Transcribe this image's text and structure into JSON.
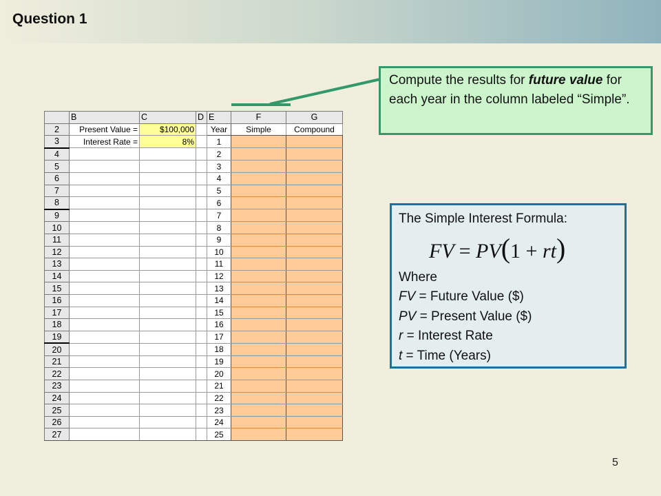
{
  "slide": {
    "title": "Question 1",
    "page_number": "5"
  },
  "callout": {
    "text_1": "Compute the results for ",
    "text_bold": "future value",
    "text_2": " for each year in the column labeled “Simple”."
  },
  "formula_box": {
    "heading": "The Simple Interest Formula:",
    "formula_lhs": "FV",
    "formula_eq": "=",
    "formula_rhs_pv": "PV",
    "formula_open": "(",
    "formula_one": "1",
    "formula_plus": "+",
    "formula_rt": "rt",
    "formula_close": ")",
    "where": "Where",
    "defs": [
      {
        "sym": "FV",
        "desc": " = Future Value ($)"
      },
      {
        "sym": "PV",
        "desc": " = Present Value ($)"
      },
      {
        "sym": "r",
        "desc": " = Interest Rate"
      },
      {
        "sym": "t",
        "desc": " = Time (Years)"
      }
    ]
  },
  "spreadsheet": {
    "columns": [
      "B",
      "C",
      "D",
      "E",
      "F",
      "G"
    ],
    "row2": {
      "row": "2",
      "B": "Present Value =",
      "C": "$100,000",
      "E": "Year",
      "F": "Simple",
      "G": "Compound"
    },
    "row3": {
      "row": "3",
      "B": "Interest Rate =",
      "C": "8%",
      "E": "1"
    },
    "year_rows": [
      {
        "row": "4",
        "year": "2"
      },
      {
        "row": "5",
        "year": "3"
      },
      {
        "row": "6",
        "year": "4"
      },
      {
        "row": "7",
        "year": "5"
      },
      {
        "row": "8",
        "year": "6"
      },
      {
        "row": "9",
        "year": "7"
      },
      {
        "row": "10",
        "year": "8"
      },
      {
        "row": "11",
        "year": "9"
      },
      {
        "row": "12",
        "year": "10"
      },
      {
        "row": "13",
        "year": "11"
      },
      {
        "row": "14",
        "year": "12"
      },
      {
        "row": "15",
        "year": "13"
      },
      {
        "row": "16",
        "year": "14"
      },
      {
        "row": "17",
        "year": "15"
      },
      {
        "row": "18",
        "year": "16"
      },
      {
        "row": "19",
        "year": "17"
      },
      {
        "row": "20",
        "year": "18"
      },
      {
        "row": "21",
        "year": "19"
      },
      {
        "row": "22",
        "year": "20"
      },
      {
        "row": "23",
        "year": "21"
      },
      {
        "row": "24",
        "year": "22"
      },
      {
        "row": "25",
        "year": "23"
      },
      {
        "row": "26",
        "year": "24"
      },
      {
        "row": "27",
        "year": "25"
      }
    ]
  },
  "colors": {
    "background": "#f0eedd",
    "callout_fill": "#ccf5cc",
    "callout_border": "#33996b",
    "formula_fill": "#e4eeee",
    "formula_border": "#1f6f9a",
    "input_fill": "#ffff99",
    "output_fill": "#ffcc99"
  }
}
